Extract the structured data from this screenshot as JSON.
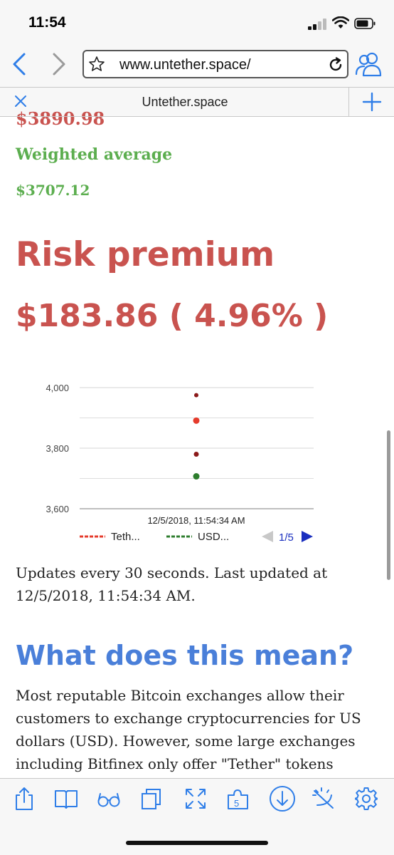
{
  "status": {
    "time": "11:54"
  },
  "browser": {
    "url": "www.untether.space/",
    "tab_title": "Untether.space"
  },
  "content": {
    "cut_price": "$3890.98",
    "weighted_label": "Weighted average",
    "weighted_value": "$3707.12",
    "risk_title": "Risk premium",
    "risk_value": "$183.86 ( 4.96% )",
    "updates_text": "Updates every 30 seconds. Last updated at 12/5/2018, 11:54:34 AM.",
    "section_title": "What does this mean?",
    "paragraph": "Most reputable Bitcoin exchanges allow their customers to exchange cryptocurrencies for US dollars (USD). However, some large exchanges including Bitfinex only offer \"Tether\" tokens instead, which are supposedly backed one-for-one by US dollars."
  },
  "chart_data": {
    "type": "scatter",
    "x_label_text": "12/5/2018, 11:54:34 AM",
    "y_ticks": [
      "4,000",
      "3,800",
      "3,600"
    ],
    "ylim": [
      3600,
      4000
    ],
    "grid": true,
    "points": [
      {
        "y": 3975,
        "color": "#8b1a1a",
        "r": 3
      },
      {
        "y": 3891,
        "color": "#e53b2c",
        "r": 4.5
      },
      {
        "y": 3780,
        "color": "#8b1a1a",
        "r": 3.5
      },
      {
        "y": 3707,
        "color": "#2d7d2d",
        "r": 4.5
      }
    ],
    "legend": [
      {
        "label": "Teth...",
        "color": "#e53b2c"
      },
      {
        "label": "USD...",
        "color": "#2d7d2d"
      }
    ],
    "pager": "1/5",
    "legend_position": "bottom"
  },
  "colors": {
    "red": "#c9534f",
    "green": "#5cae4f",
    "blue": "#4a7fd9",
    "ios_blue": "#2f7ee8"
  },
  "toolbar_icons": [
    "share-icon",
    "bookmarks-icon",
    "reader-icon",
    "tabs-icon",
    "fullscreen-icon",
    "extensions-icon",
    "download-icon",
    "night-mode-icon",
    "settings-icon"
  ]
}
